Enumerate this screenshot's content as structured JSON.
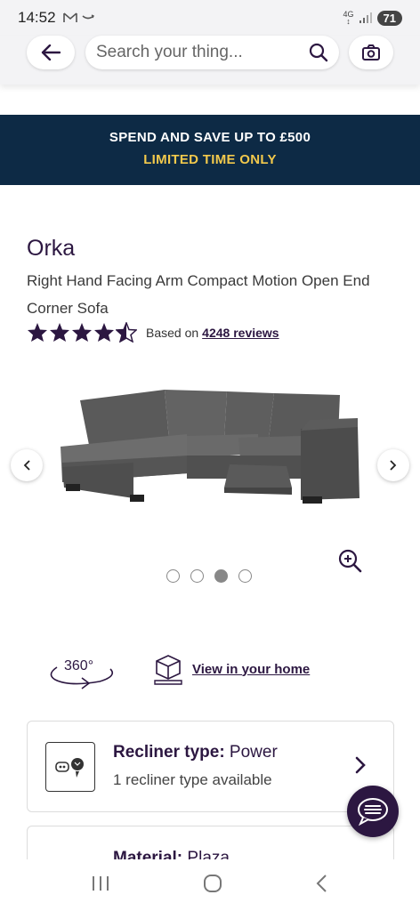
{
  "status_bar": {
    "time": "14:52",
    "net_top": "4G",
    "battery": "71"
  },
  "search": {
    "placeholder": "Search your thing..."
  },
  "promo": {
    "line1": "SPEND AND SAVE UP TO £500",
    "line2": "LIMITED TIME ONLY"
  },
  "product": {
    "name": "Orka",
    "description": "Right Hand Facing Arm Compact Motion Open End Corner Sofa",
    "rating": 4.5,
    "rating_prefix": "Based on",
    "reviews_link": "4248 reviews"
  },
  "carousel": {
    "total_images": 4,
    "active_index": 2
  },
  "views": {
    "label_360": "360°",
    "view_home": "View in your home"
  },
  "cards": {
    "recliner": {
      "title_bold": "Recliner type:",
      "title_value": " Power",
      "subtitle": "1 recliner type available"
    },
    "material": {
      "title_bold": "Material:",
      "title_value": " Plaza"
    }
  },
  "colors": {
    "brand_purple": "#2c1741",
    "promo_bg": "#0d2a45",
    "promo_accent": "#f2c94c"
  }
}
